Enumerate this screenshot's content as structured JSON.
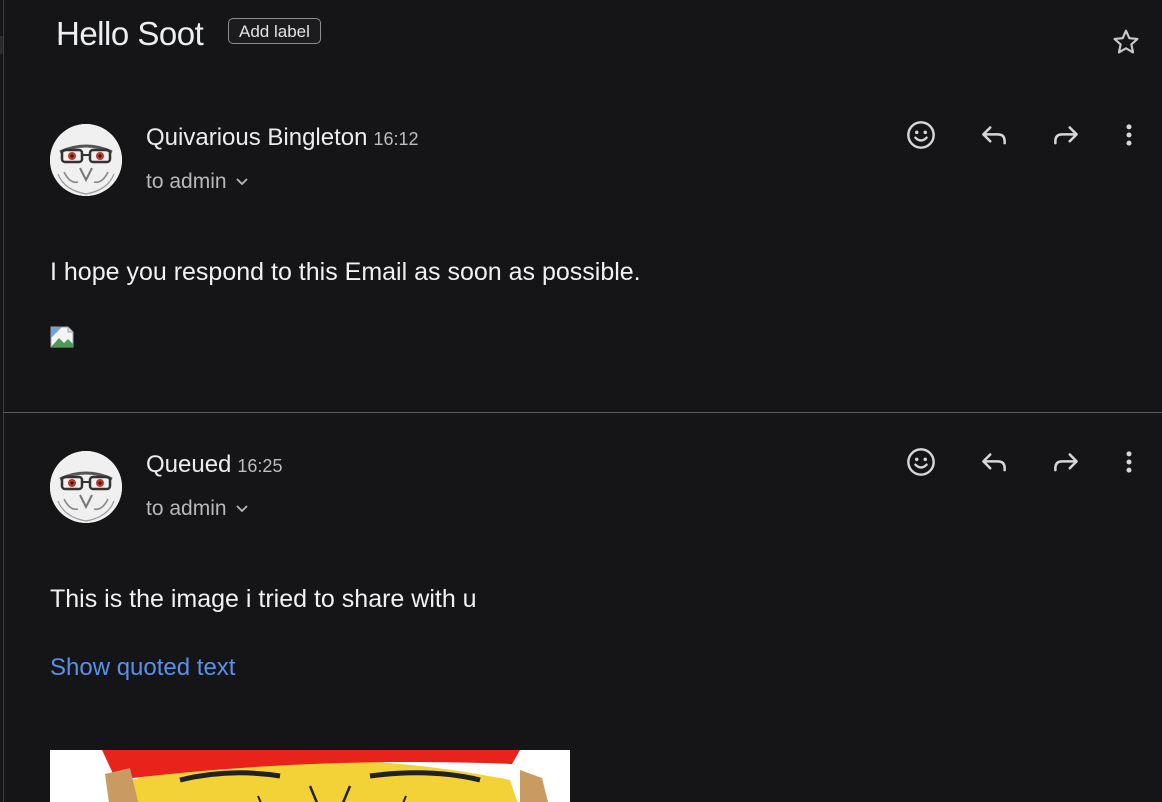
{
  "thread": {
    "subject": "Hello Soot",
    "label_button": "Add label",
    "star_icon": "star-outline-icon"
  },
  "messages": [
    {
      "sender": "Quivarious Bingleton",
      "time": "16:12",
      "recipient": "to admin",
      "body": "I hope you respond to this Email as soon as possible.",
      "has_broken_image": true,
      "actions": [
        "emoji-icon",
        "reply-icon",
        "forward-icon",
        "more-vert-icon"
      ]
    },
    {
      "sender": "Queued",
      "time": "16:25",
      "recipient": "to admin",
      "body": "This is the image i tried to share with u",
      "quoted_link": "Show quoted text",
      "actions": [
        "emoji-icon",
        "reply-icon",
        "forward-icon",
        "more-vert-icon"
      ]
    }
  ],
  "colors": {
    "background": "#151517",
    "text": "#e8eaed",
    "link": "#5b8fe8",
    "divider": "#5a5a5e"
  }
}
